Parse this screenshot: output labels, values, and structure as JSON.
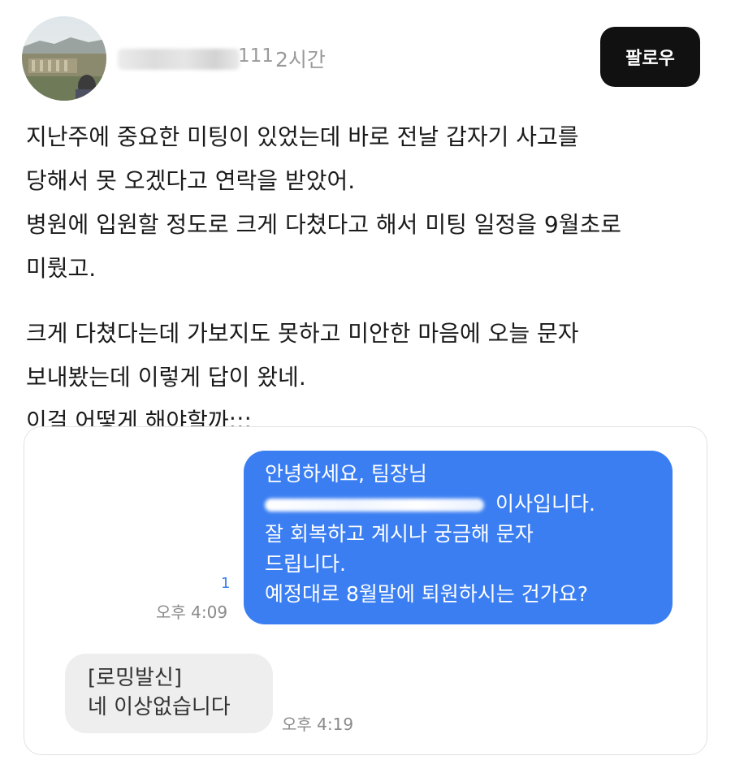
{
  "header": {
    "username_visible": "111",
    "post_time": "2시간",
    "follow_label": "팔로우"
  },
  "post": {
    "paragraphs": [
      [
        "지난주에 중요한 미팅이 있었는데 바로 전날 갑자기 사고를",
        "당해서 못 오겠다고 연락을 받았어.",
        "병원에 입원할 정도로 크게 다쳤다고 해서 미팅 일정을 9월초로",
        "미뤘고."
      ],
      [
        "크게 다쳤다는데 가보지도 못하고 미안한 마음에 오늘 문자",
        "보내봤는데 이렇게 답이 왔네.",
        "이걸 어떻게 해야할까;;;"
      ]
    ]
  },
  "screenshot": {
    "sent": {
      "lines": [
        "안녕하세요, 팀장님",
        "이사입니다.",
        "잘 회복하고 계시나 궁금해 문자",
        "드립니다.",
        "예정대로 8월말에 퇴원하시는 건가요?"
      ],
      "unread_count": "1",
      "time": "오후 4:09"
    },
    "received": {
      "lines": [
        "[로밍발신]",
        "네 이상없습니다"
      ],
      "time": "오후 4:19"
    }
  },
  "colors": {
    "sent_bubble": "#3a7ef2",
    "received_bubble": "#eeeeee",
    "follow_button": "#111111"
  }
}
